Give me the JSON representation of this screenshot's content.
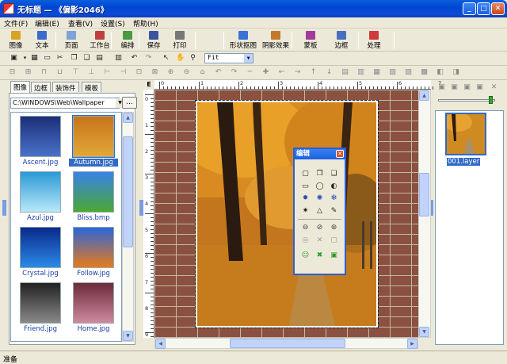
{
  "window": {
    "title": "无标题 — 《偏影2046》",
    "controls": {
      "minimize": "_",
      "maximize": "□",
      "close": "✕"
    }
  },
  "menu": [
    {
      "label": "文件(F)"
    },
    {
      "label": "编辑(E)"
    },
    {
      "label": "查看(V)"
    },
    {
      "label": "设置(S)"
    },
    {
      "label": "帮助(H)"
    }
  ],
  "toolbar_main": [
    {
      "label": "图像",
      "icon": "image-icon",
      "color": "#d9a321"
    },
    {
      "label": "文本",
      "icon": "text-icon",
      "color": "#3a6bd0"
    },
    {
      "label": "页面",
      "icon": "page-icon",
      "color": "#7fa3d8"
    },
    {
      "label": "工作台",
      "icon": "workbench-icon",
      "color": "#c04040"
    },
    {
      "label": "编排",
      "icon": "arrange-icon",
      "color": "#4a9a42"
    },
    {
      "label": "保存",
      "icon": "save-icon",
      "color": "#3a55a0"
    },
    {
      "label": "打印",
      "icon": "print-icon",
      "color": "#777777"
    },
    {
      "label": "形状抠图",
      "icon": "shape-cutout-icon",
      "color": "#3a73d8"
    },
    {
      "label": "阴影效果",
      "icon": "shadow-icon",
      "color": "#c07a2a"
    },
    {
      "label": "蒙板",
      "icon": "mask-icon",
      "color": "#a33a9a"
    },
    {
      "label": "边框",
      "icon": "frame-icon",
      "color": "#4a6fbf"
    },
    {
      "label": "处理",
      "icon": "process-icon",
      "color": "#cf3a3a"
    }
  ],
  "zoom": {
    "value": "Fit"
  },
  "left_panel": {
    "tabs": [
      {
        "label": "图像",
        "active": true
      },
      {
        "label": "边框",
        "active": false
      },
      {
        "label": "装饰件",
        "active": false
      },
      {
        "label": "模板",
        "active": false
      }
    ],
    "path": "C:\\WINDOWS\\Web\\Wallpaper",
    "browse_label": "...",
    "thumbnails": [
      {
        "label": "Ascent.jpg",
        "selected": false,
        "top": "#1c2f7a",
        "bottom": "#4a72c8"
      },
      {
        "label": "Autumn.jpg",
        "selected": true,
        "top": "#c8741c",
        "bottom": "#e0a838"
      },
      {
        "label": "Azul.jpg",
        "selected": false,
        "top": "#2a9ad6",
        "bottom": "#b8e8f8"
      },
      {
        "label": "Bliss.bmp",
        "selected": false,
        "top": "#3a82e8",
        "bottom": "#4aa832"
      },
      {
        "label": "Crystal.jpg",
        "selected": false,
        "top": "#0a2a8a",
        "bottom": "#2a8ae8"
      },
      {
        "label": "Follow.jpg",
        "selected": false,
        "top": "#2a66d8",
        "bottom": "#e87a1a"
      },
      {
        "label": "Friend.jpg",
        "selected": false,
        "top": "#222222",
        "bottom": "#8a8a8a"
      },
      {
        "label": "Home.jpg",
        "selected": false,
        "top": "#6a2a3a",
        "bottom": "#d08aa0"
      }
    ]
  },
  "palette": {
    "title": "编辑",
    "close_label": "✕"
  },
  "right_panel": {
    "layer_label": "001.layer"
  },
  "status": {
    "text": "准备"
  },
  "ruler": {
    "h_labels": [
      "0",
      "1",
      "2",
      "3",
      "4",
      "5",
      "6",
      "7"
    ],
    "v_labels": [
      "0",
      "1",
      "2",
      "3",
      "4",
      "5",
      "6",
      "7",
      "8",
      "9"
    ]
  }
}
